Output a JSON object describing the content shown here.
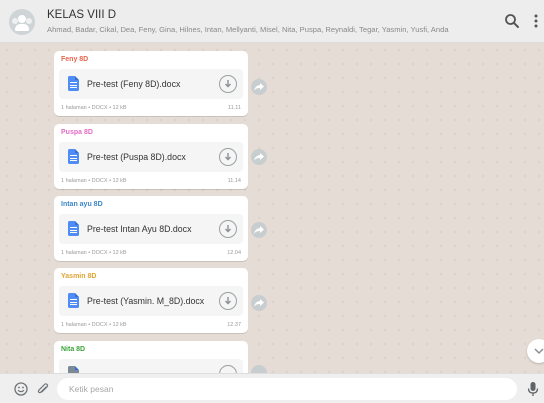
{
  "header": {
    "title": "KELAS VIII D",
    "members": "Ahmad, Badar, Cikal, Dea, Feny, Gina, Hilnes, Intan, Mellyanti, Misel, Nita, Puspa, Reynaldi, Tegar, Yasmin, Yusfi, Anda",
    "icons": [
      "group-avatar",
      "search-icon",
      "menu-icon"
    ]
  },
  "messages": [
    {
      "sender": "Feny 8D",
      "sender_color": "#e8654a",
      "file_name": "Pre-test (Feny 8D).docx",
      "meta": "1 halaman • DOCX • 12 kB",
      "time": "11.11"
    },
    {
      "sender": "Puspa 8D",
      "sender_color": "#e46bc6",
      "file_name": "Pre-test (Puspa 8D).docx",
      "meta": "1 halaman • DOCX • 12 kB",
      "time": "11.14"
    },
    {
      "sender": "Intan ayu 8D",
      "sender_color": "#3b86c9",
      "file_name": "Pre-test Intan Ayu 8D.docx",
      "meta": "1 halaman • DOCX • 12 kB",
      "time": "12.04"
    },
    {
      "sender": "Yasmin 8D",
      "sender_color": "#e0a436",
      "file_name": "Pre-test (Yasmin. M_8D).docx",
      "meta": "1 halaman • DOCX • 12 kB",
      "time": "12.37"
    },
    {
      "sender": "Nita 8D",
      "sender_color": "#3aa33a",
      "file_name": "",
      "meta": "",
      "time": ""
    }
  ],
  "footer": {
    "placeholder": "Ketik pesan",
    "icons": [
      "emoji-icon",
      "attach-icon",
      "mic-icon"
    ]
  }
}
